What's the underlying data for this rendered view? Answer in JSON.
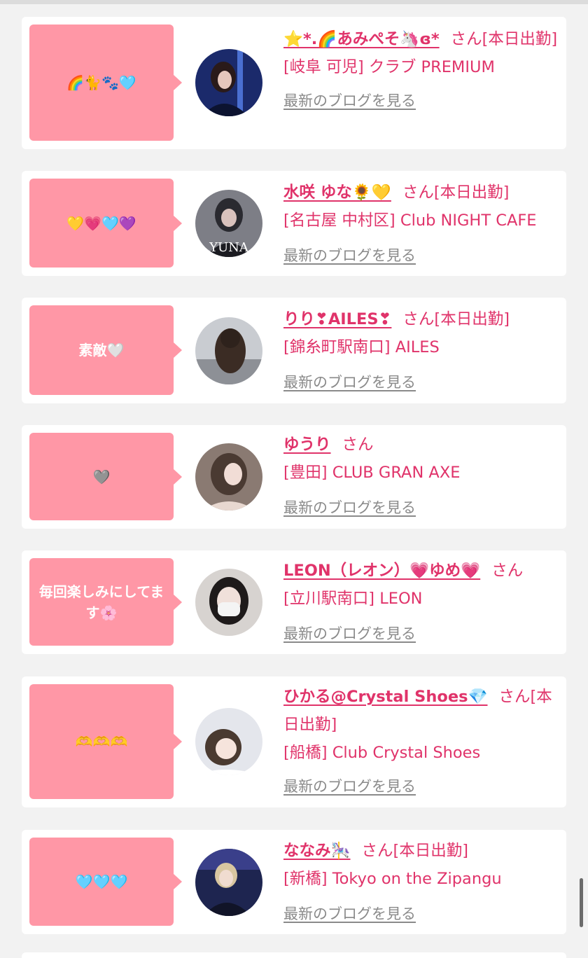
{
  "feed": {
    "items": [
      {
        "message": "🌈🐈🐾🩵",
        "name": "⭐*.🌈あみぺそ🦄ɞ*",
        "san": "さん",
        "status": "[本日出勤]",
        "shop": "[岐阜 可児] クラブ PREMIUM",
        "blog": "最新のブログを見る"
      },
      {
        "message": "💛💗🩵💜",
        "name": "水咲 ゆな🌻💛",
        "san": "さん",
        "status": "[本日出勤]",
        "shop": "[名古屋 中村区] Club NIGHT CAFE",
        "blog": "最新のブログを見る"
      },
      {
        "message": "素敵🤍",
        "name": "りり❣AILES❣",
        "san": "さん",
        "status": "[本日出勤]",
        "shop": "[錦糸町駅南口] AILES",
        "blog": "最新のブログを見る"
      },
      {
        "message": "🩶",
        "name": "ゆうり",
        "san": "さん",
        "status": "",
        "shop": "[豊田] CLUB GRAN AXE",
        "blog": "最新のブログを見る"
      },
      {
        "message": "毎回楽しみにしてます🌸",
        "name": "LEON（レオン）💗ゆめ💗",
        "san": "さん",
        "status": "",
        "shop": "[立川駅南口] LEON",
        "blog": "最新のブログを見る"
      },
      {
        "message": "🫶🫶🫶",
        "name": "ひかる@Crystal Shoes💎",
        "san": "さん",
        "status": "[本日出勤]",
        "shop": "[船橋] Club Crystal Shoes",
        "blog": "最新のブログを見る"
      },
      {
        "message": "🩵🩵🩵",
        "name": "ななみ🎠",
        "san": "さん",
        "status": "[本日出勤]",
        "shop": "[新橋] Tokyo on the Zipangu",
        "blog": "最新のブログを見る"
      }
    ]
  },
  "avatars": [
    {
      "label": "",
      "bg": "#1b2a6b",
      "fg": "#4a6fd1"
    },
    {
      "label": "YUNA",
      "bg": "#7d7e86",
      "fg": "#2a2a30"
    },
    {
      "label": "",
      "bg": "#c9ccd1",
      "fg": "#3b2c24"
    },
    {
      "label": "",
      "bg": "#8a7a72",
      "fg": "#e8d8d0"
    },
    {
      "label": "",
      "bg": "#d7d3d0",
      "fg": "#f4f4f4"
    },
    {
      "label": "",
      "bg": "#e4e6ec",
      "fg": "#4a3a30"
    },
    {
      "label": "",
      "bg": "#1e2550",
      "fg": "#d8c6a0"
    }
  ],
  "colors": {
    "bubble": "#ff97a6",
    "accent": "#e0336a",
    "link_gray": "#8a8a8a",
    "page_bg": "#f2f2f2"
  }
}
